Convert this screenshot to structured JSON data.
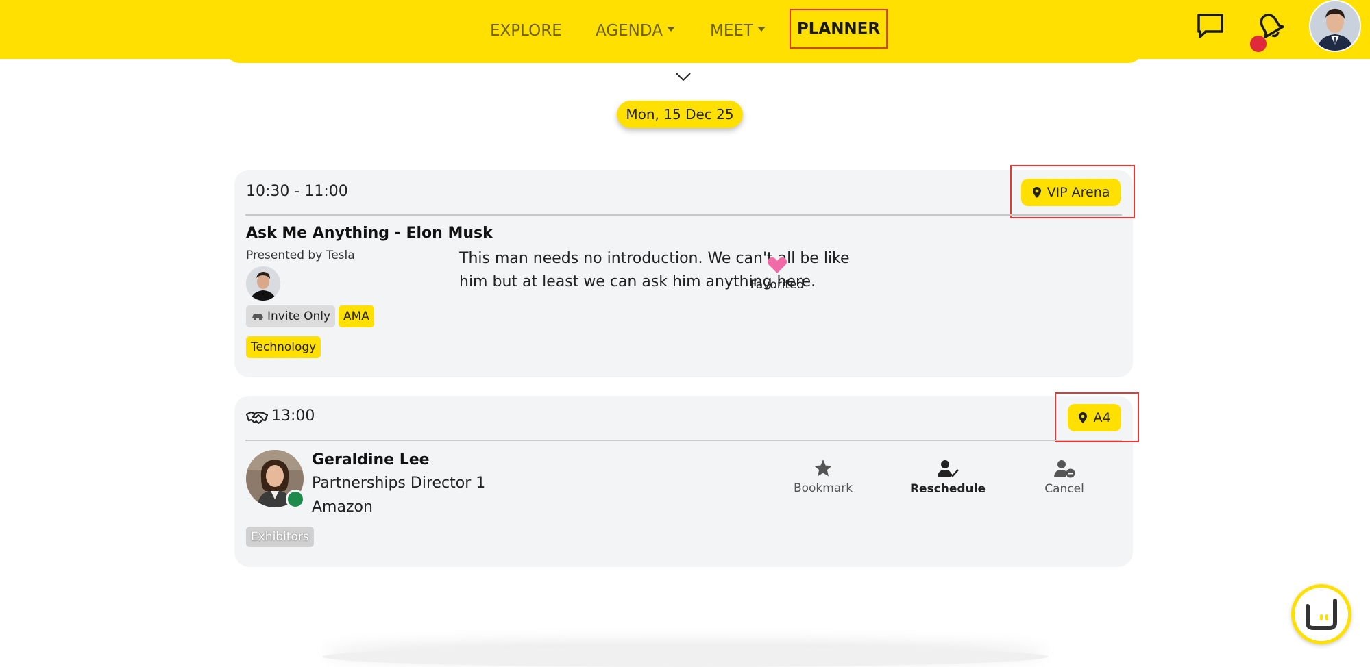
{
  "nav": {
    "explore": "EXPLORE",
    "agenda": "AGENDA",
    "meet": "MEET",
    "planner": "PLANNER"
  },
  "icons": {
    "chat": "chat-bubble-icon",
    "notifications": "bell-icon",
    "location": "map-pin-icon",
    "heart": "heart-icon",
    "handshake": "handshake-icon",
    "bookmark": "star-icon",
    "reschedule": "user-check-icon",
    "cancel": "user-minus-icon",
    "chevron": "chevron-down-icon",
    "invite": "car-icon",
    "assistant": "assistant-face-icon"
  },
  "colors": {
    "brand_yellow": "#ffe000",
    "highlight_red": "#e33333",
    "heart_pink": "#f06aa5",
    "online_green": "#1e8a4c",
    "notification_red": "#e0293a"
  },
  "date": "Mon, 15 Dec 25",
  "session": {
    "time": "10:30 - 11:00",
    "location": "VIP Arena",
    "title": "Ask Me Anything - Elon Musk",
    "presented_by": "Presented by Tesla",
    "description": "This man needs no introduction. We can't all be like him but at least we can ask him anything here.",
    "tags": [
      "Invite Only",
      "AMA",
      "Technology"
    ],
    "favorite_label": "Favorited"
  },
  "meeting": {
    "time": "13:00",
    "location": "A4",
    "person": {
      "name": "Geraldine Lee",
      "title": "Partnerships Director 1",
      "company": "Amazon",
      "group": "Exhibitors"
    },
    "actions": {
      "bookmark": "Bookmark",
      "reschedule": "Reschedule",
      "cancel": "Cancel"
    }
  }
}
